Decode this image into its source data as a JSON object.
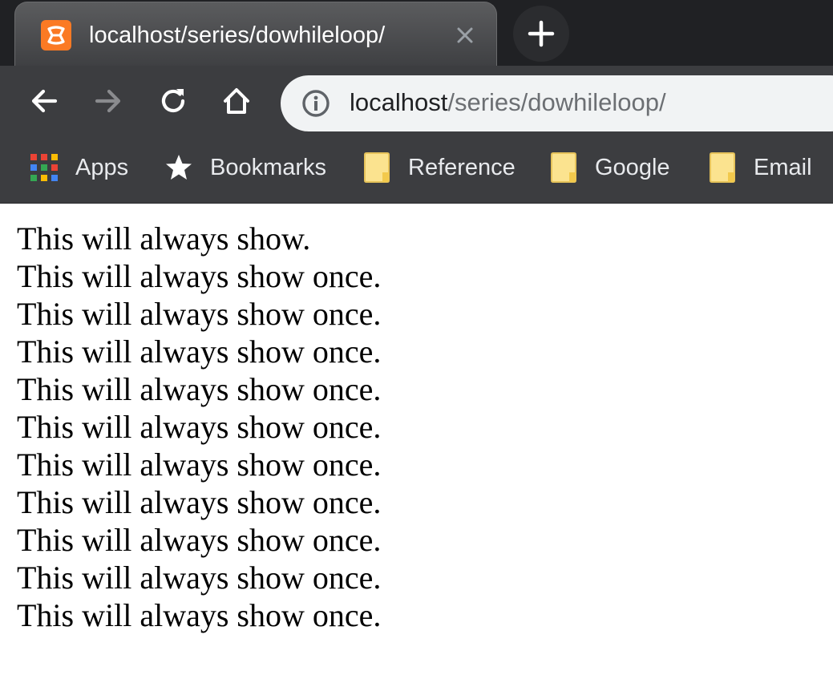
{
  "colors": {
    "tabstrip_bg": "#202124",
    "active_tab_bg": "#4a4b4e",
    "toolbar_bg": "#3c3d40",
    "omnibox_bg": "#f1f3f4",
    "favicon_accent": "#fb7a24",
    "page_bg": "#ffffff",
    "page_text": "#000000"
  },
  "tab": {
    "title": "localhost/series/dowhileloop/",
    "favicon": "xampp-icon",
    "close_icon": "close-icon"
  },
  "newtab": {
    "icon": "plus-icon"
  },
  "toolbar": {
    "back_icon": "arrow-left-icon",
    "forward_icon": "arrow-right-icon",
    "reload_icon": "reload-icon",
    "home_icon": "home-icon"
  },
  "omnibox": {
    "info_icon": "info-icon",
    "host": "localhost",
    "path": "/series/dowhileloop/"
  },
  "bookmarks": {
    "items": [
      {
        "label": "Apps",
        "icon": "apps-grid-icon"
      },
      {
        "label": "Bookmarks",
        "icon": "star-icon"
      },
      {
        "label": "Reference",
        "icon": "folder-icon"
      },
      {
        "label": "Google",
        "icon": "folder-icon"
      },
      {
        "label": "Email",
        "icon": "folder-icon"
      }
    ]
  },
  "page": {
    "lines": [
      "This will always show.",
      "This will always show once.",
      "This will always show once.",
      "This will always show once.",
      "This will always show once.",
      "This will always show once.",
      "This will always show once.",
      "This will always show once.",
      "This will always show once.",
      "This will always show once.",
      "This will always show once."
    ]
  }
}
